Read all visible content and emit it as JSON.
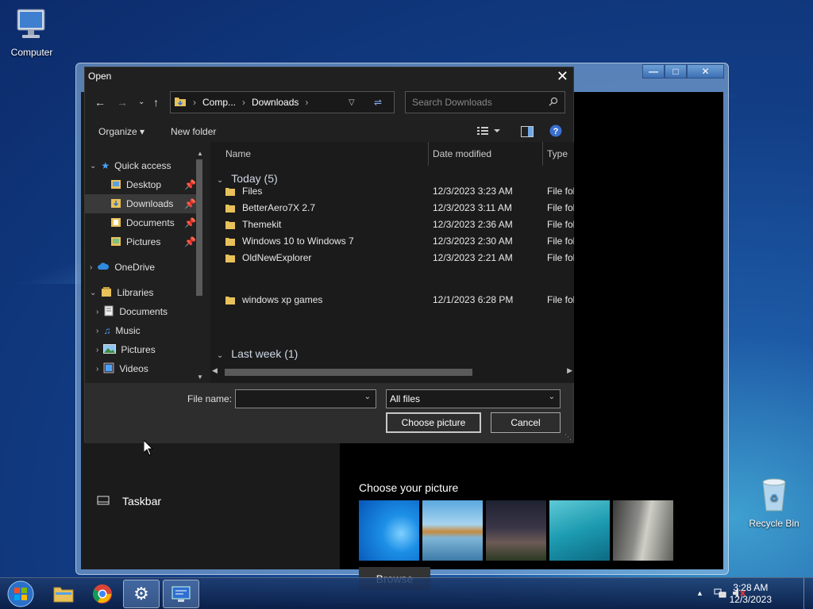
{
  "desktop": {
    "computer_label": "Computer",
    "recycle_label": "Recycle Bin"
  },
  "settings_window": {
    "taskbar_item": "Taskbar",
    "choose_picture_label": "Choose your picture",
    "browse_label": "Browse",
    "caption_minimize": "—",
    "caption_maximize": "□",
    "caption_close": "✕"
  },
  "dialog": {
    "title": "Open",
    "close_glyph": "✕",
    "breadcrumb": [
      "Comp...",
      "Downloads"
    ],
    "search_placeholder": "Search Downloads",
    "organize_label": "Organize ▾",
    "new_folder_label": "New folder",
    "nav": {
      "quick_access": "Quick access",
      "desktop": "Desktop",
      "downloads": "Downloads",
      "documents": "Documents",
      "pictures": "Pictures",
      "onedrive": "OneDrive",
      "libraries": "Libraries",
      "lib_documents": "Documents",
      "lib_music": "Music",
      "lib_pictures": "Pictures",
      "lib_videos": "Videos"
    },
    "columns": {
      "name": "Name",
      "date": "Date modified",
      "type": "Type"
    },
    "groups": [
      {
        "label": "Today (5)",
        "items": [
          {
            "name": "Files",
            "date": "12/3/2023 3:23 AM",
            "type": "File folder"
          },
          {
            "name": "BetterAero7X 2.7",
            "date": "12/3/2023 3:11 AM",
            "type": "File folder"
          },
          {
            "name": "Themekit",
            "date": "12/3/2023 2:36 AM",
            "type": "File folder"
          },
          {
            "name": "Windows 10 to Windows 7",
            "date": "12/3/2023 2:30 AM",
            "type": "File folder"
          },
          {
            "name": "OldNewExplorer",
            "date": "12/3/2023 2:21 AM",
            "type": "File folder"
          }
        ]
      },
      {
        "label": "Last week (1)",
        "items": [
          {
            "name": "windows xp games",
            "date": "12/1/2023 6:28 PM",
            "type": "File folder"
          }
        ]
      }
    ],
    "file_name_label": "File name:",
    "file_name_value": "",
    "filter_value": "All files",
    "choose_button": "Choose picture",
    "cancel_button": "Cancel"
  },
  "taskbar": {
    "time": "3:28 AM",
    "date": "12/3/2023"
  },
  "colors": {
    "accent": "#3c6fb3",
    "folder": "#e8c15a",
    "dialog_bg": "#202020"
  }
}
